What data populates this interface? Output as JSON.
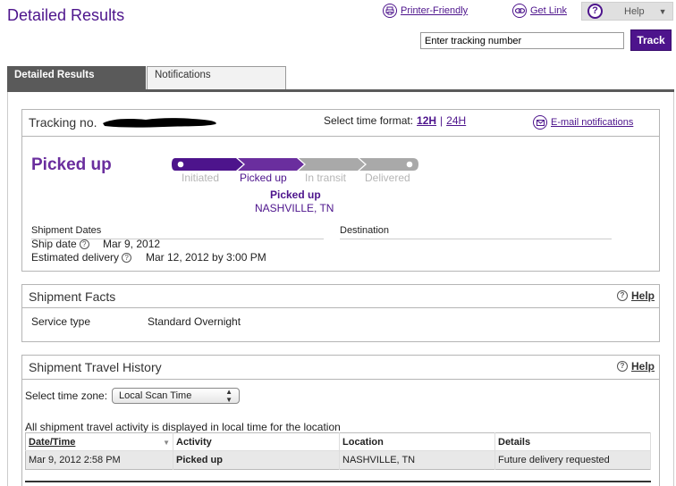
{
  "header": {
    "title": "Detailed Results",
    "printer_friendly": "Printer-Friendly",
    "get_link": "Get Link",
    "help": "Help"
  },
  "track": {
    "input_value": "Enter tracking number",
    "button_label": "Track"
  },
  "tabs": [
    {
      "label": "Detailed Results",
      "active": true
    },
    {
      "label": "Notifications",
      "active": false
    }
  ],
  "tracking": {
    "label": "Tracking no.",
    "time_format_label": "Select time format:",
    "time_format_options": [
      "12H",
      "24H"
    ],
    "time_format_separator": "|",
    "email_notifications": "E-mail notifications",
    "status": "Picked up",
    "progress_stages": [
      "Initiated",
      "Picked up",
      "In transit",
      "Delivered"
    ],
    "current_stage_index": 1,
    "current_status": "Picked up",
    "current_location": "NASHVILLE, TN",
    "shipment_dates_title": "Shipment Dates",
    "destination_title": "Destination",
    "ship_date_label": "Ship date",
    "ship_date_value": "Mar 9, 2012",
    "estimated_delivery_label": "Estimated delivery",
    "estimated_delivery_value": "Mar 12, 2012 by 3:00 PM"
  },
  "facts": {
    "title": "Shipment Facts",
    "help": "Help",
    "service_type_label": "Service type",
    "service_type_value": "Standard Overnight"
  },
  "history": {
    "title": "Shipment Travel History",
    "help": "Help",
    "time_zone_label": "Select time zone:",
    "time_zone_value": "Local Scan Time",
    "note": "All shipment travel activity is displayed in local time for the location",
    "columns": [
      "Date/Time",
      "Activity",
      "Location",
      "Details"
    ],
    "rows": [
      {
        "datetime": "Mar 9, 2012 2:58 PM",
        "activity": "Picked up",
        "location": "NASHVILLE, TN",
        "details": "Future delivery requested"
      }
    ]
  },
  "colors": {
    "brand_purple": "#4d148c",
    "status_purple": "#6a2e9e",
    "progress_inactive": "#a9a9a9",
    "tab_active_bg": "#5a5a5a"
  },
  "icons": [
    "printer-icon",
    "link-icon",
    "help-icon",
    "envelope-icon",
    "question-icon",
    "sort-arrow-icon",
    "chevron-updown-icon"
  ]
}
